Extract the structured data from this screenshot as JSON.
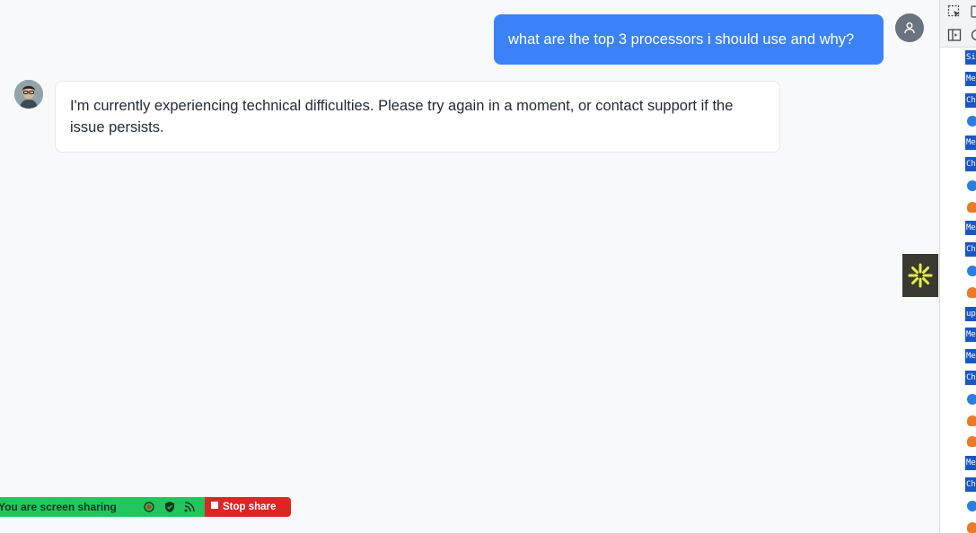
{
  "chat": {
    "user_message": "what are the top 3 processors i should use and why?",
    "bot_message": "I'm currently experiencing technical difficulties. Please try again in a moment, or contact support if the issue persists."
  },
  "icons": {
    "user_avatar": "user-icon",
    "bot_avatar": "bot-avatar-image",
    "widget": "asterisk-icon"
  },
  "devtools": {
    "rows": [
      {
        "type": "badge",
        "text": "Si"
      },
      {
        "type": "badge",
        "text": "Me"
      },
      {
        "type": "badge",
        "text": "Ch"
      },
      {
        "type": "circle"
      },
      {
        "type": "badge",
        "text": "Me"
      },
      {
        "type": "badge",
        "text": "Ch"
      },
      {
        "type": "circle"
      },
      {
        "type": "flame"
      },
      {
        "type": "badge",
        "text": "Me"
      },
      {
        "type": "badge",
        "text": "Ch"
      },
      {
        "type": "circle"
      },
      {
        "type": "flame"
      },
      {
        "type": "badge",
        "text": "up"
      },
      {
        "type": "badge",
        "text": "Me"
      },
      {
        "type": "badge",
        "text": "Me"
      },
      {
        "type": "badge",
        "text": "Ch"
      },
      {
        "type": "circle"
      },
      {
        "type": "flame"
      },
      {
        "type": "flame"
      },
      {
        "type": "badge",
        "text": "Me"
      },
      {
        "type": "badge",
        "text": "Ch"
      },
      {
        "type": "circle"
      },
      {
        "type": "flame"
      }
    ]
  },
  "share_bar": {
    "status_text": "You are screen sharing",
    "stop_label": "Stop share"
  },
  "colors": {
    "user_bubble": "#3b82f6",
    "share_green": "#22c55e",
    "stop_red": "#dc2626",
    "devtools_badge": "#1a56c4"
  }
}
